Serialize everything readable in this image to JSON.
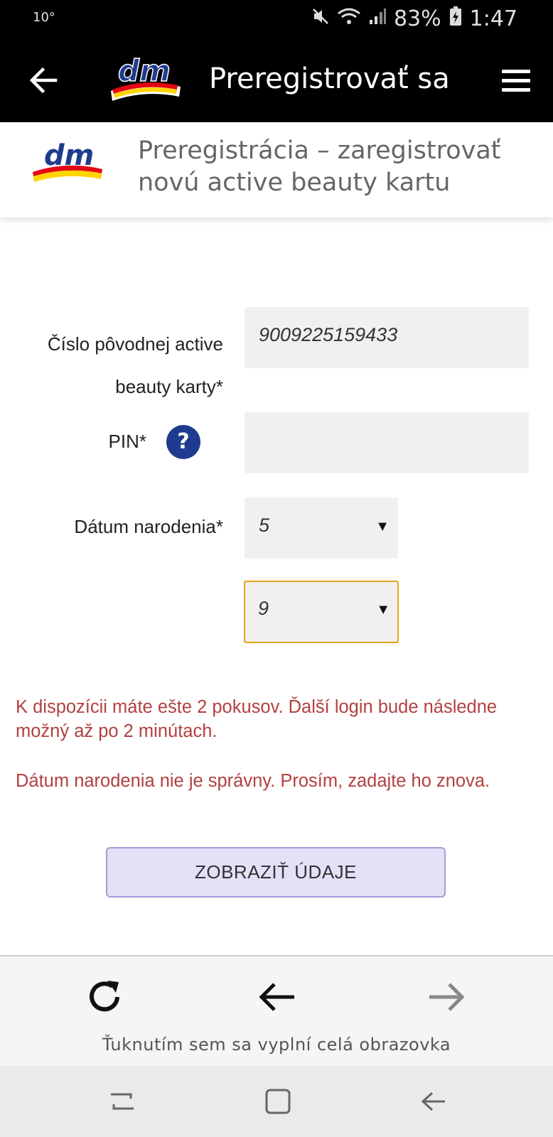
{
  "status_bar": {
    "temperature": "10°",
    "battery": "83%",
    "time": "1:47"
  },
  "app_bar": {
    "title": "Preregistrovať sa",
    "logo_text": "dm"
  },
  "page_header": {
    "heading": "Preregistrácia – zaregistrovať novú active beauty kartu",
    "logo_text": "dm"
  },
  "form": {
    "card_number": {
      "label": "Číslo pôvodnej active beauty karty*",
      "value": "9009225159433"
    },
    "pin": {
      "label": "PIN*",
      "value": "",
      "help_symbol": "?"
    },
    "birth_date": {
      "label": "Dátum narodenia*",
      "day": "5",
      "month": "9"
    }
  },
  "errors": {
    "attempts": "K dispozícii máte ešte 2 pokusov. Ďalší login bude následne možný až po 2 minútach.",
    "invalid_date": "Dátum narodenia nie je správny. Prosím, zadajte ho znova."
  },
  "submit_button": {
    "label": "ZOBRAZIŤ ÚDAJE"
  },
  "browser_bar": {
    "hint": "Ťuknutím sem sa vyplní celá obrazovka"
  },
  "colors": {
    "accent_focus": "#e5a21a",
    "error": "#b2413f",
    "button_bg": "#e3e0f8",
    "brand_blue": "#1f3b8f"
  }
}
